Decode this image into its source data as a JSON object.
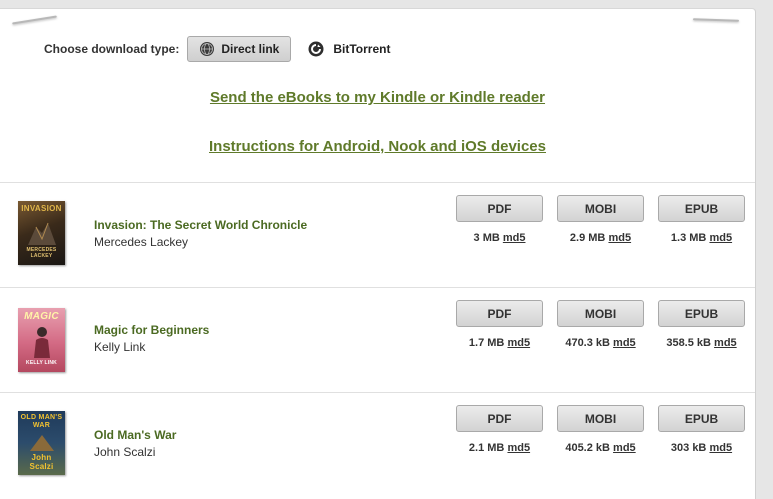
{
  "download_type": {
    "label": "Choose download type:",
    "options": [
      {
        "label": "Direct link",
        "icon": "globe-icon",
        "selected": true
      },
      {
        "label": "BitTorrent",
        "icon": "torrent-icon",
        "selected": false
      }
    ]
  },
  "links": {
    "kindle": "Send the eBooks to my Kindle or Kindle reader",
    "devices": "Instructions for Android, Nook and iOS devices"
  },
  "colors": {
    "link_green": "#5f7a2a",
    "title_green": "#4b6a22",
    "button_gray": "#d3d3d3"
  },
  "books": [
    {
      "title": "Invasion: The Secret World Chronicle",
      "author": "Mercedes Lackey",
      "cover_title": "INVASION",
      "cover_author": "MERCEDES LACKEY",
      "formats": [
        {
          "label": "PDF",
          "size": "3 MB",
          "md5": "md5"
        },
        {
          "label": "MOBI",
          "size": "2.9 MB",
          "md5": "md5"
        },
        {
          "label": "EPUB",
          "size": "1.3 MB",
          "md5": "md5"
        }
      ]
    },
    {
      "title": "Magic for Beginners",
      "author": "Kelly Link",
      "cover_title": "MAGIC",
      "cover_author": "KELLY LINK",
      "formats": [
        {
          "label": "PDF",
          "size": "1.7 MB",
          "md5": "md5"
        },
        {
          "label": "MOBI",
          "size": "470.3 kB",
          "md5": "md5"
        },
        {
          "label": "EPUB",
          "size": "358.5 kB",
          "md5": "md5"
        }
      ]
    },
    {
      "title": "Old Man's War",
      "author": "John Scalzi",
      "cover_title": "OLD MAN'S WAR",
      "cover_author": "John Scalzi",
      "formats": [
        {
          "label": "PDF",
          "size": "2.1 MB",
          "md5": "md5"
        },
        {
          "label": "MOBI",
          "size": "405.2 kB",
          "md5": "md5"
        },
        {
          "label": "EPUB",
          "size": "303 kB",
          "md5": "md5"
        }
      ]
    }
  ]
}
